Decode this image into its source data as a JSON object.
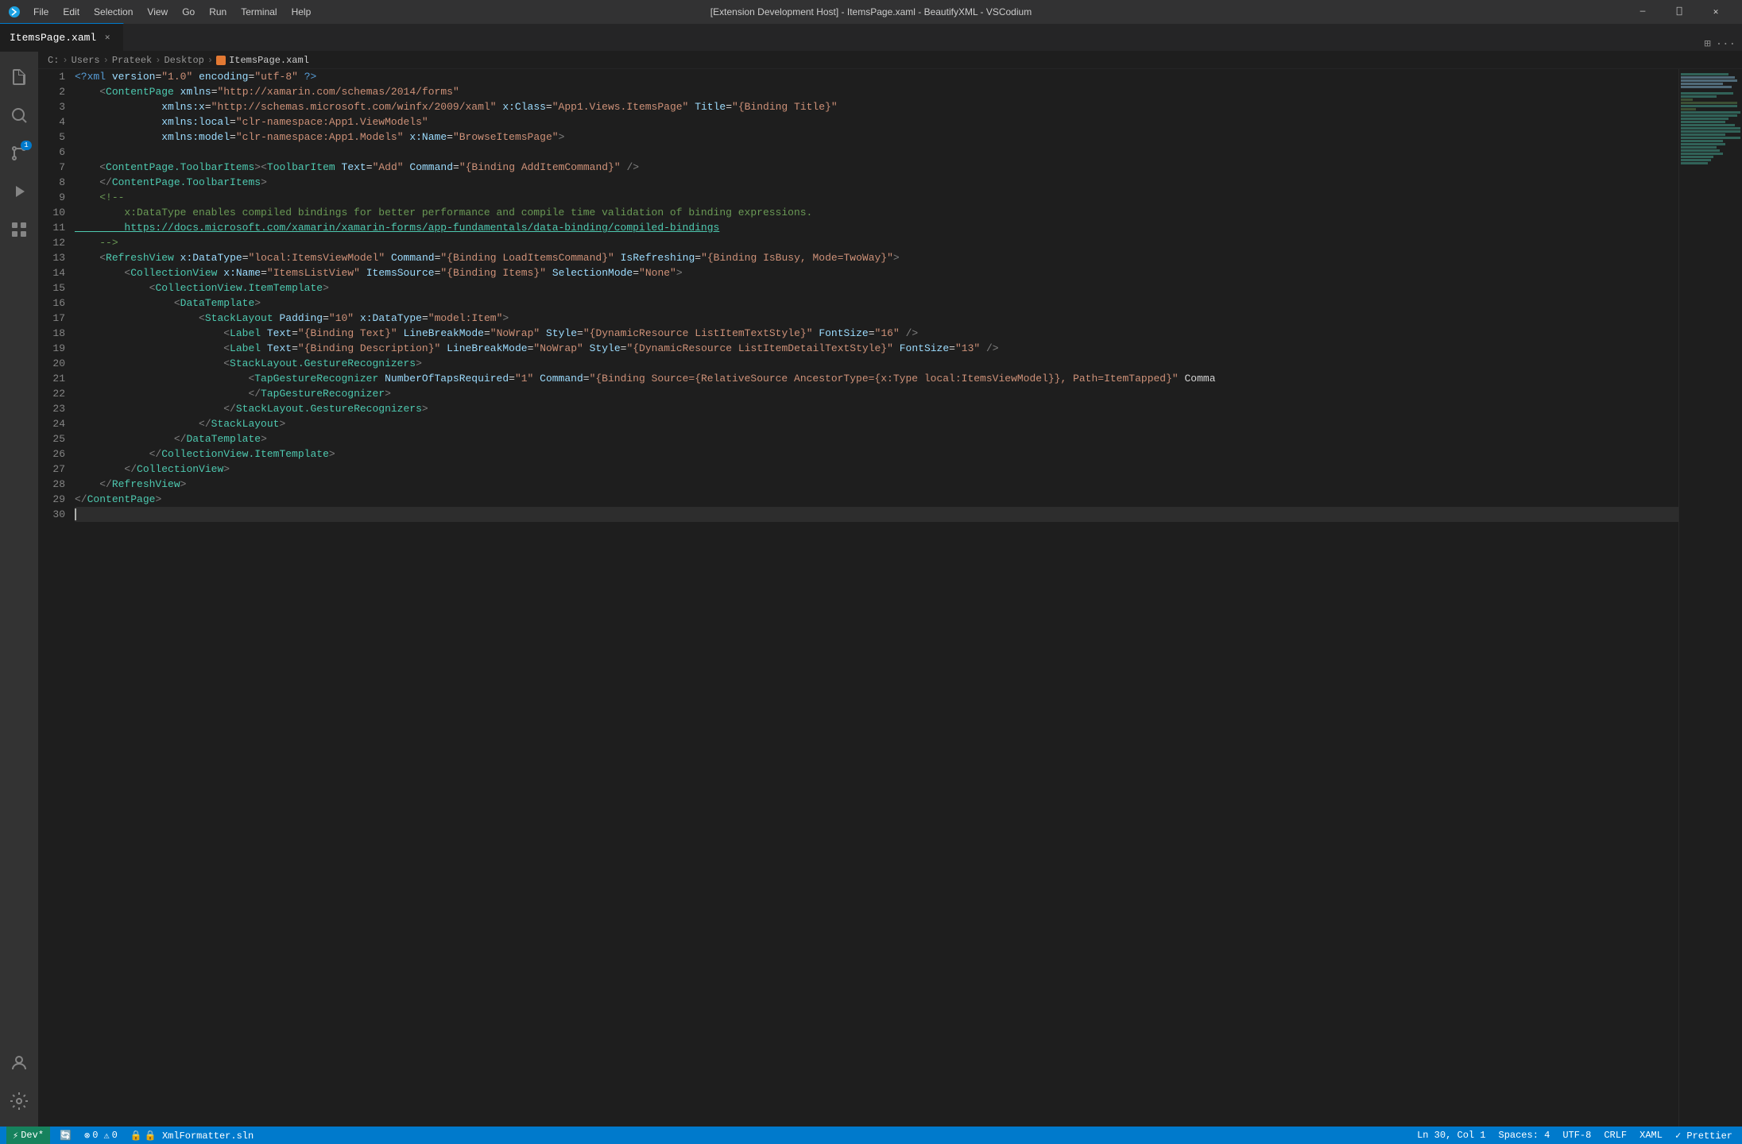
{
  "titleBar": {
    "title": "[Extension Development Host] - ItemsPage.xaml - BeautifyXML - VSCodium",
    "menuItems": [
      "File",
      "Edit",
      "Selection",
      "View",
      "Go",
      "Run",
      "Terminal",
      "Help"
    ],
    "controls": [
      "minimize",
      "maximize",
      "close"
    ]
  },
  "tabs": [
    {
      "label": "ItemsPage.xaml",
      "active": true,
      "modified": false
    }
  ],
  "breadcrumb": {
    "path": [
      "C:",
      "Users",
      "Prateek",
      "Desktop"
    ],
    "current": "ItemsPage.xaml"
  },
  "activityBar": {
    "items": [
      {
        "id": "explorer",
        "icon": "📄",
        "active": false
      },
      {
        "id": "search",
        "icon": "🔍",
        "active": false
      },
      {
        "id": "source-control",
        "icon": "⎇",
        "active": false,
        "badge": "1"
      },
      {
        "id": "run-debug",
        "icon": "▷",
        "active": false
      },
      {
        "id": "extensions",
        "icon": "⊞",
        "active": false
      }
    ],
    "bottomItems": [
      {
        "id": "account",
        "icon": "👤"
      },
      {
        "id": "settings",
        "icon": "⚙"
      }
    ]
  },
  "statusBar": {
    "left": [
      {
        "id": "dev",
        "text": "⚡ Dev*"
      },
      {
        "id": "sync",
        "text": "🔄"
      },
      {
        "id": "errors",
        "text": "⊗ 0  ⚠ 0"
      },
      {
        "id": "formatter",
        "text": "🔒 XmlFormatter.sln"
      }
    ],
    "right": [
      {
        "id": "position",
        "text": "Ln 30, Col 1"
      },
      {
        "id": "spaces",
        "text": "Spaces: 4"
      },
      {
        "id": "encoding",
        "text": "UTF-8"
      },
      {
        "id": "lineending",
        "text": "CRLF"
      },
      {
        "id": "language",
        "text": "XAML"
      },
      {
        "id": "prettier",
        "text": "✓ Prettier"
      }
    ]
  },
  "codeLines": [
    {
      "num": 1,
      "html": "<span class='xml-prolog'>&lt;?xml</span><span class='xml-text'> </span><span class='xml-attr'>version</span><span class='xml-equals'>=</span><span class='xml-value'>\"1.0\"</span><span class='xml-text'> </span><span class='xml-attr'>encoding</span><span class='xml-equals'>=</span><span class='xml-value'>\"utf-8\"</span><span class='xml-text'> </span><span class='xml-prolog'>?&gt;</span>"
    },
    {
      "num": 2,
      "html": "<span class='xml-text'>    </span><span class='xml-bracket'>&lt;</span><span class='xml-tag'>ContentPage</span><span class='xml-text'> </span><span class='xml-attr'>xmlns</span><span class='xml-equals'>=</span><span class='xml-value'>\"http://xamarin.com/schemas/2014/forms\"</span>"
    },
    {
      "num": 3,
      "html": "<span class='xml-text'>              </span><span class='xml-attr'>xmlns:x</span><span class='xml-equals'>=</span><span class='xml-value'>\"http://schemas.microsoft.com/winfx/2009/xaml\"</span><span class='xml-text'> </span><span class='xml-attr'>x:Class</span><span class='xml-equals'>=</span><span class='xml-value'>\"App1.Views.ItemsPage\"</span><span class='xml-text'> </span><span class='xml-attr'>Title</span><span class='xml-equals'>=</span><span class='xml-value'>\"{Binding Title}\"</span>"
    },
    {
      "num": 4,
      "html": "<span class='xml-text'>              </span><span class='xml-attr'>xmlns:local</span><span class='xml-equals'>=</span><span class='xml-value'>\"clr-namespace:App1.ViewModels\"</span>"
    },
    {
      "num": 5,
      "html": "<span class='xml-text'>              </span><span class='xml-attr'>xmlns:model</span><span class='xml-equals'>=</span><span class='xml-value'>\"clr-namespace:App1.Models\"</span><span class='xml-text'> </span><span class='xml-attr'>x:Name</span><span class='xml-equals'>=</span><span class='xml-value'>\"BrowseItemsPage\"</span><span class='xml-bracket'>&gt;</span>"
    },
    {
      "num": 6,
      "html": ""
    },
    {
      "num": 7,
      "html": "<span class='xml-text'>    </span><span class='xml-bracket'>&lt;</span><span class='xml-tag'>ContentPage.ToolbarItems</span><span class='xml-bracket'>&gt;</span><span class='xml-bracket'>&lt;</span><span class='xml-tag'>ToolbarItem</span><span class='xml-text'> </span><span class='xml-attr'>Text</span><span class='xml-equals'>=</span><span class='xml-value'>\"Add\"</span><span class='xml-text'> </span><span class='xml-attr'>Command</span><span class='xml-equals'>=</span><span class='xml-value'>\"{Binding AddItemCommand}\"</span><span class='xml-text'> </span><span class='xml-bracket'>/&gt;</span>"
    },
    {
      "num": 8,
      "html": "<span class='xml-text'>    </span><span class='xml-bracket'>&lt;/</span><span class='xml-tag'>ContentPage.ToolbarItems</span><span class='xml-bracket'>&gt;</span>"
    },
    {
      "num": 9,
      "html": "<span class='xml-text'>    </span><span class='xml-comment'>&lt;!--</span>"
    },
    {
      "num": 10,
      "html": "<span class='xml-comment'>        x:DataType enables compiled bindings for better performance and compile time validation of binding expressions.</span>"
    },
    {
      "num": 11,
      "html": "<span class='xml-link'>        https://docs.microsoft.com/xamarin/xamarin-forms/app-fundamentals/data-binding/compiled-bindings</span>"
    },
    {
      "num": 12,
      "html": "<span class='xml-text'>    </span><span class='xml-comment'>--&gt;</span>"
    },
    {
      "num": 13,
      "html": "<span class='xml-text'>    </span><span class='xml-bracket'>&lt;</span><span class='xml-tag'>RefreshView</span><span class='xml-text'> </span><span class='xml-attr'>x:DataType</span><span class='xml-equals'>=</span><span class='xml-value'>\"local:ItemsViewModel\"</span><span class='xml-text'> </span><span class='xml-attr'>Command</span><span class='xml-equals'>=</span><span class='xml-value'>\"{Binding LoadItemsCommand}\"</span><span class='xml-text'> </span><span class='xml-attr'>IsRefreshing</span><span class='xml-equals'>=</span><span class='xml-value'>\"{Binding IsBusy, Mode=TwoWay}\"</span><span class='xml-bracket'>&gt;</span>"
    },
    {
      "num": 14,
      "html": "<span class='xml-text'>        </span><span class='xml-bracket'>&lt;</span><span class='xml-tag'>CollectionView</span><span class='xml-text'> </span><span class='xml-attr'>x:Name</span><span class='xml-equals'>=</span><span class='xml-value'>\"ItemsListView\"</span><span class='xml-text'> </span><span class='xml-attr'>ItemsSource</span><span class='xml-equals'>=</span><span class='xml-value'>\"{Binding Items}\"</span><span class='xml-text'> </span><span class='xml-attr'>SelectionMode</span><span class='xml-equals'>=</span><span class='xml-value'>\"None\"</span><span class='xml-bracket'>&gt;</span>"
    },
    {
      "num": 15,
      "html": "<span class='xml-text'>            </span><span class='xml-bracket'>&lt;</span><span class='xml-tag'>CollectionView.ItemTemplate</span><span class='xml-bracket'>&gt;</span>"
    },
    {
      "num": 16,
      "html": "<span class='xml-text'>                </span><span class='xml-bracket'>&lt;</span><span class='xml-tag'>DataTemplate</span><span class='xml-bracket'>&gt;</span>"
    },
    {
      "num": 17,
      "html": "<span class='xml-text'>                    </span><span class='xml-bracket'>&lt;</span><span class='xml-tag'>StackLayout</span><span class='xml-text'> </span><span class='xml-attr'>Padding</span><span class='xml-equals'>=</span><span class='xml-value'>\"10\"</span><span class='xml-text'> </span><span class='xml-attr'>x:DataType</span><span class='xml-equals'>=</span><span class='xml-value'>\"model:Item\"</span><span class='xml-bracket'>&gt;</span>"
    },
    {
      "num": 18,
      "html": "<span class='xml-text'>                        </span><span class='xml-bracket'>&lt;</span><span class='xml-tag'>Label</span><span class='xml-text'> </span><span class='xml-attr'>Text</span><span class='xml-equals'>=</span><span class='xml-value'>\"{Binding Text}\"</span><span class='xml-text'> </span><span class='xml-attr'>LineBreakMode</span><span class='xml-equals'>=</span><span class='xml-value'>\"NoWrap\"</span><span class='xml-text'> </span><span class='xml-attr'>Style</span><span class='xml-equals'>=</span><span class='xml-value'>\"{DynamicResource ListItemTextStyle}\"</span><span class='xml-text'> </span><span class='xml-attr'>FontSize</span><span class='xml-equals'>=</span><span class='xml-value'>\"16\"</span><span class='xml-text'> </span><span class='xml-bracket'>/&gt;</span>"
    },
    {
      "num": 19,
      "html": "<span class='xml-text'>                        </span><span class='xml-bracket'>&lt;</span><span class='xml-tag'>Label</span><span class='xml-text'> </span><span class='xml-attr'>Text</span><span class='xml-equals'>=</span><span class='xml-value'>\"{Binding Description}\"</span><span class='xml-text'> </span><span class='xml-attr'>LineBreakMode</span><span class='xml-equals'>=</span><span class='xml-value'>\"NoWrap\"</span><span class='xml-text'> </span><span class='xml-attr'>Style</span><span class='xml-equals'>=</span><span class='xml-value'>\"{DynamicResource ListItemDetailTextStyle}\"</span><span class='xml-text'> </span><span class='xml-attr'>FontSize</span><span class='xml-equals'>=</span><span class='xml-value'>\"13\"</span><span class='xml-text'> </span><span class='xml-bracket'>/&gt;</span>"
    },
    {
      "num": 20,
      "html": "<span class='xml-text'>                        </span><span class='xml-bracket'>&lt;</span><span class='xml-tag'>StackLayout.GestureRecognizers</span><span class='xml-bracket'>&gt;</span>"
    },
    {
      "num": 21,
      "html": "<span class='xml-text'>                            </span><span class='xml-bracket'>&lt;</span><span class='xml-tag'>TapGestureRecognizer</span><span class='xml-text'> </span><span class='xml-attr'>NumberOfTapsRequired</span><span class='xml-equals'>=</span><span class='xml-value'>\"1\"</span><span class='xml-text'> </span><span class='xml-attr'>Command</span><span class='xml-equals'>=</span><span class='xml-value'>\"{Binding Source={RelativeSource AncestorType={x:Type local:ItemsViewModel}}, Path=ItemTapped}\"</span><span class='xml-text'> Comma</span>"
    },
    {
      "num": 22,
      "html": "<span class='xml-text'>                            </span><span class='xml-bracket'>&lt;/</span><span class='xml-tag'>TapGestureRecognizer</span><span class='xml-bracket'>&gt;</span>"
    },
    {
      "num": 23,
      "html": "<span class='xml-text'>                        </span><span class='xml-bracket'>&lt;/</span><span class='xml-tag'>StackLayout.GestureRecognizers</span><span class='xml-bracket'>&gt;</span>"
    },
    {
      "num": 24,
      "html": "<span class='xml-text'>                    </span><span class='xml-bracket'>&lt;/</span><span class='xml-tag'>StackLayout</span><span class='xml-bracket'>&gt;</span>"
    },
    {
      "num": 25,
      "html": "<span class='xml-text'>                </span><span class='xml-bracket'>&lt;/</span><span class='xml-tag'>DataTemplate</span><span class='xml-bracket'>&gt;</span>"
    },
    {
      "num": 26,
      "html": "<span class='xml-text'>            </span><span class='xml-bracket'>&lt;/</span><span class='xml-tag'>CollectionView.ItemTemplate</span><span class='xml-bracket'>&gt;</span>"
    },
    {
      "num": 27,
      "html": "<span class='xml-text'>        </span><span class='xml-bracket'>&lt;/</span><span class='xml-tag'>CollectionView</span><span class='xml-bracket'>&gt;</span>"
    },
    {
      "num": 28,
      "html": "<span class='xml-text'>    </span><span class='xml-bracket'>&lt;/</span><span class='xml-tag'>RefreshView</span><span class='xml-bracket'>&gt;</span>"
    },
    {
      "num": 29,
      "html": "<span class='xml-bracket'>&lt;/</span><span class='xml-tag'>ContentPage</span><span class='xml-bracket'>&gt;</span>"
    },
    {
      "num": 30,
      "html": ""
    }
  ]
}
